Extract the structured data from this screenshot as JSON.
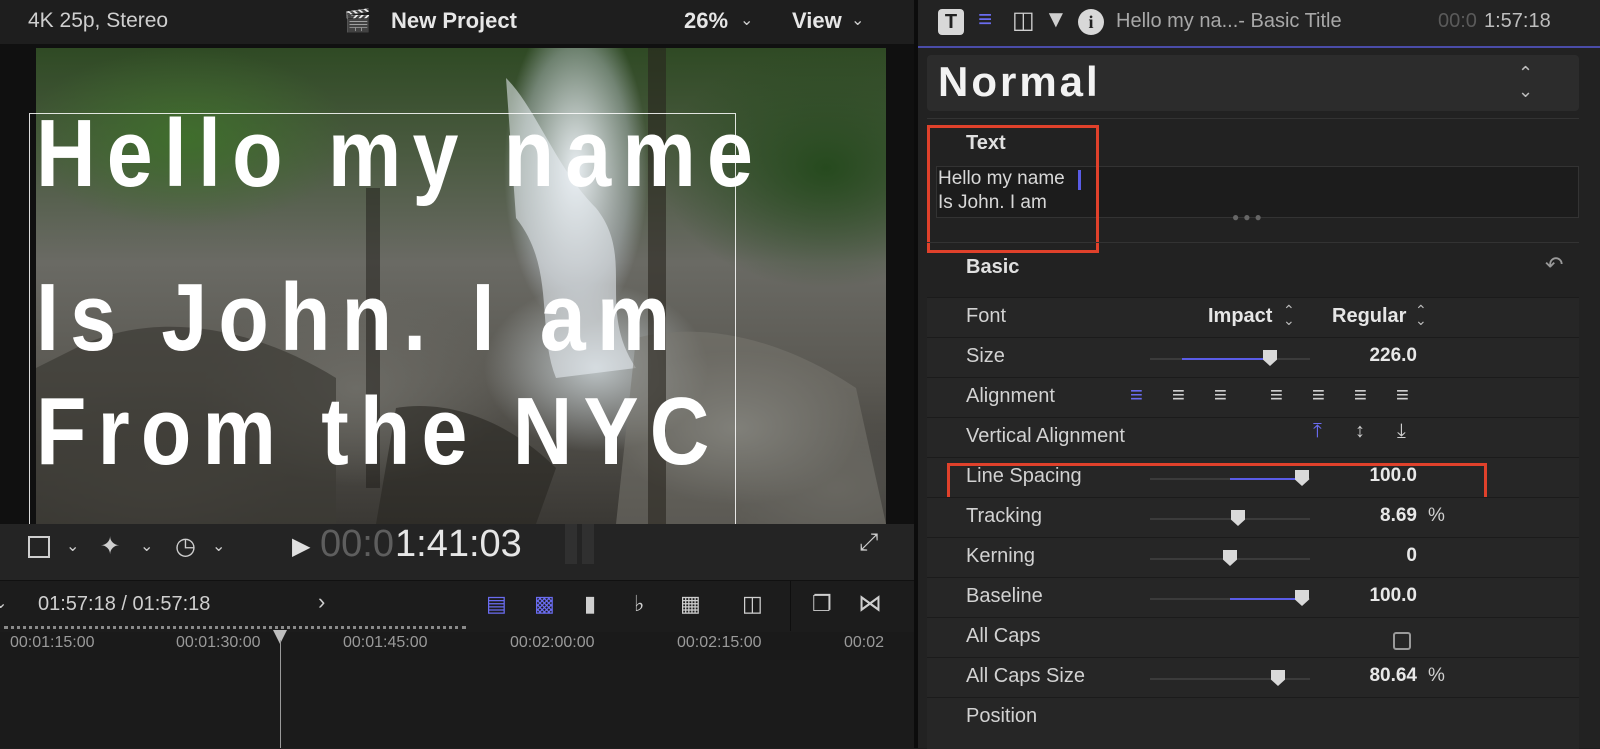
{
  "viewer": {
    "format": "4K 25p, Stereo",
    "project": "New Project",
    "zoom": "26%",
    "view": "View",
    "title_lines": [
      "Hello my name",
      "Is John. I am",
      "From the NYC"
    ]
  },
  "transport": {
    "timecode_dim": "00:0",
    "timecode_bright": "1:41:03"
  },
  "timeline": {
    "position": "01:57:18 / 01:57:18",
    "ruler_ticks": [
      "00:01:15:00",
      "00:01:30:00",
      "00:01:45:00",
      "00:02:00:00",
      "00:02:15:00",
      "00:02"
    ]
  },
  "inspector": {
    "clip_name": "Hello my na...- Basic Title",
    "timecode_dim": "00:0",
    "timecode_bright": "1:57:18",
    "preset": "Normal",
    "text_section": "Text",
    "text_value_line1": "Hello my name",
    "text_value_line2": "Is John. I am",
    "basic_section": "Basic",
    "rows": {
      "font": {
        "label": "Font",
        "family": "Impact",
        "style": "Regular"
      },
      "size": {
        "label": "Size",
        "value": "226.0",
        "fraction": 0.75
      },
      "alignment": {
        "label": "Alignment"
      },
      "vertical_alignment": {
        "label": "Vertical Alignment"
      },
      "line_spacing": {
        "label": "Line Spacing",
        "value": "100.0",
        "fraction": 0.95
      },
      "tracking": {
        "label": "Tracking",
        "value": "8.69",
        "unit": "%",
        "fraction": 0.55
      },
      "kerning": {
        "label": "Kerning",
        "value": "0",
        "fraction": 0.5
      },
      "baseline": {
        "label": "Baseline",
        "value": "100.0",
        "fraction": 0.95
      },
      "all_caps": {
        "label": "All Caps",
        "checked": false
      },
      "all_caps_size": {
        "label": "All Caps Size",
        "value": "80.64",
        "unit": "%",
        "fraction": 0.8
      },
      "position": {
        "label": "Position"
      }
    }
  },
  "colors": {
    "accent": "#5a5ce6",
    "highlight_box": "#e0412b"
  }
}
